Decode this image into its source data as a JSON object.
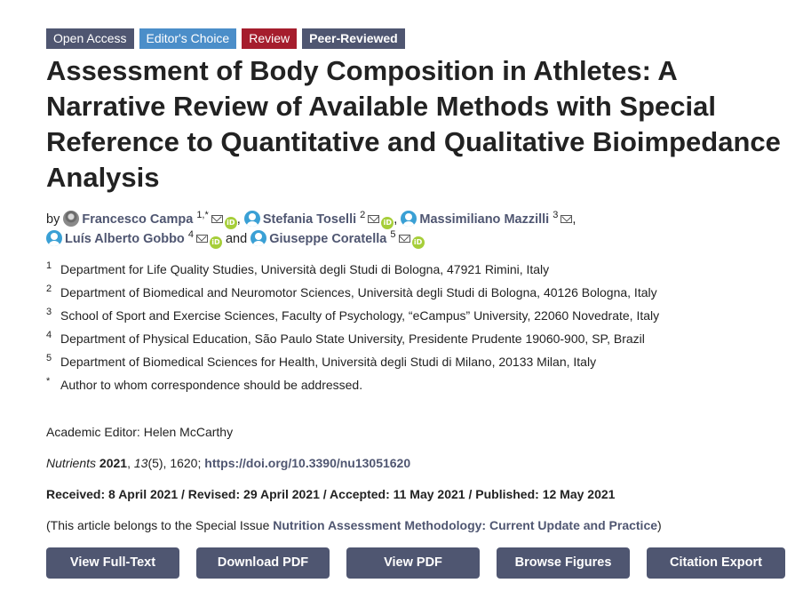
{
  "badges": {
    "open_access": "Open Access",
    "editors_choice": "Editor's Choice",
    "review": "Review",
    "peer_reviewed": "Peer-Reviewed"
  },
  "title": "Assessment of Body Composition in Athletes: A Narrative Review of Available Methods with Special Reference to Quantitative and Qualitative Bioimpedance Analysis",
  "authors": {
    "by": "by",
    "and": "and",
    "list": [
      {
        "name": "Francesco Campa",
        "sup": "1,*"
      },
      {
        "name": "Stefania Toselli",
        "sup": "2"
      },
      {
        "name": "Massimiliano Mazzilli",
        "sup": "3"
      },
      {
        "name": "Luís Alberto Gobbo",
        "sup": "4"
      },
      {
        "name": "Giuseppe Coratella",
        "sup": "5"
      }
    ]
  },
  "affiliations": [
    {
      "num": "1",
      "text": "Department for Life Quality Studies, Università degli Studi di Bologna, 47921 Rimini, Italy"
    },
    {
      "num": "2",
      "text": "Department of Biomedical and Neuromotor Sciences, Università degli Studi di Bologna, 40126 Bologna, Italy"
    },
    {
      "num": "3",
      "text": "School of Sport and Exercise Sciences, Faculty of Psychology, “eCampus” University, 22060 Novedrate, Italy"
    },
    {
      "num": "4",
      "text": "Department of Physical Education, São Paulo State University, Presidente Prudente 19060-900, SP, Brazil"
    },
    {
      "num": "5",
      "text": "Department of Biomedical Sciences for Health, Università degli Studi di Milano, 20133 Milan, Italy"
    },
    {
      "num": "*",
      "text": "Author to whom correspondence should be addressed."
    }
  ],
  "editor": "Academic Editor: Helen McCarthy",
  "citation": {
    "journal": "Nutrients",
    "year": "2021",
    "volume": "13",
    "issue_pages": "(5), 1620;",
    "doi": "https://doi.org/10.3390/nu13051620"
  },
  "dates": "Received: 8 April 2021 / Revised: 29 April 2021 / Accepted: 11 May 2021 / Published: 12 May 2021",
  "special_issue": {
    "prefix": "(This article belongs to the Special Issue ",
    "link": "Nutrition Assessment Methodology: Current Update and Practice",
    "suffix": ")"
  },
  "buttons": {
    "full_text": "View Full-Text",
    "download_pdf": "Download PDF",
    "view_pdf": "View PDF",
    "browse_figures": "Browse Figures",
    "citation_export": "Citation Export"
  },
  "icons": {
    "orcid_label": "iD",
    "orcid_color": "#a6ce39",
    "avatar_color": "#3aa0d5",
    "accent_color": "#4f5671"
  }
}
